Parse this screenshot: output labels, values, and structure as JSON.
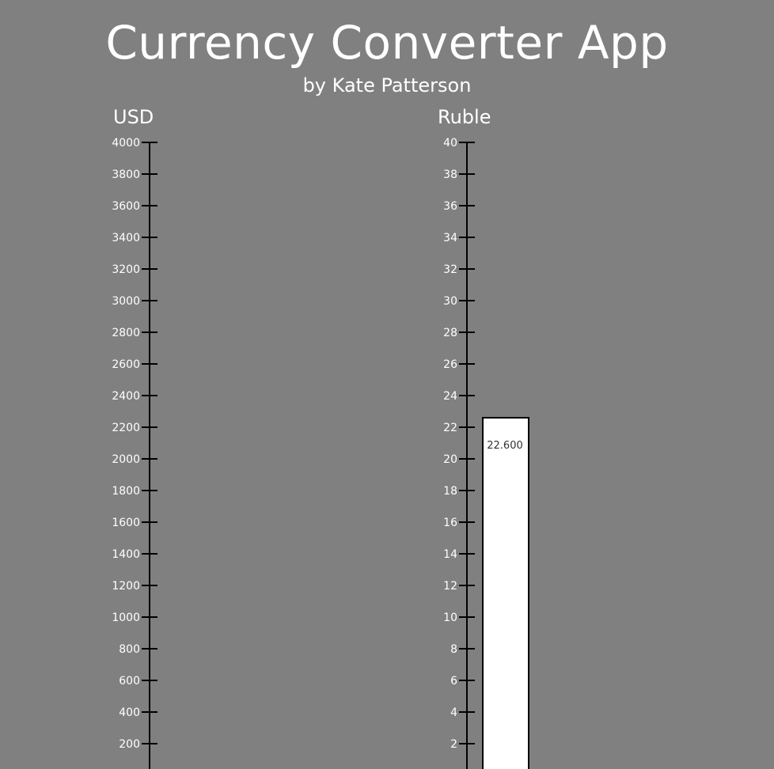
{
  "app": {
    "title": "Currency Converter App",
    "author": "by Kate Patterson"
  },
  "colors": {
    "background": "#808080",
    "text": "#ffffff",
    "axis": "#000000",
    "bar_fill": "#ffffff",
    "bar_label": "#333333"
  },
  "gauges": [
    {
      "id": "usd",
      "label": "USD",
      "min": 0,
      "max": 4000,
      "step": 200,
      "value": null,
      "value_label": ""
    },
    {
      "id": "ruble",
      "label": "Ruble",
      "min": 0,
      "max": 40,
      "step": 2,
      "value": 22.6,
      "value_label": "22.600"
    }
  ]
}
